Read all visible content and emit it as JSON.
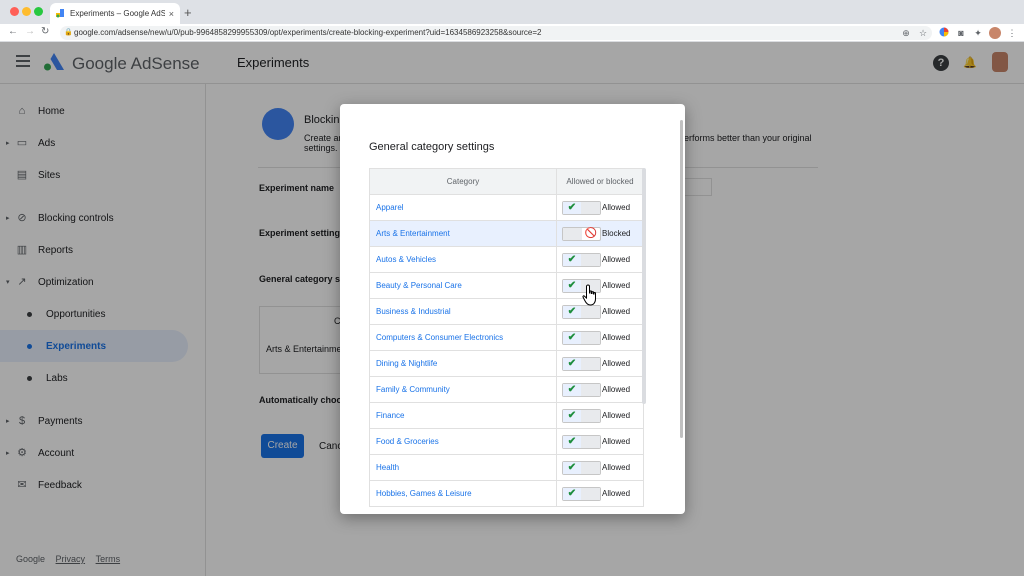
{
  "browser": {
    "tab_title": "Experiments – Google AdSense",
    "tab_close": "×",
    "new_tab": "+",
    "url": "google.com/adsense/new/u/0/pub-9964858299955309/opt/experiments/create-blocking-experiment?uid=1634586923258&source=2"
  },
  "appbar": {
    "brand": "Google AdSense",
    "page_title": "Experiments",
    "help_icon": "?",
    "bell_icon": "🔔"
  },
  "sidebar": {
    "items": [
      {
        "label": "Home",
        "icon": "home-icon"
      },
      {
        "label": "Ads",
        "icon": "ads-icon"
      },
      {
        "label": "Sites",
        "icon": "sites-icon"
      },
      {
        "label": "Blocking controls",
        "icon": "block-icon"
      },
      {
        "label": "Reports",
        "icon": "reports-icon"
      },
      {
        "label": "Optimization",
        "icon": "optimization-icon"
      },
      {
        "label": "Opportunities"
      },
      {
        "label": "Experiments"
      },
      {
        "label": "Labs"
      },
      {
        "label": "Payments",
        "icon": "payments-icon"
      },
      {
        "label": "Account",
        "icon": "account-icon"
      },
      {
        "label": "Feedback",
        "icon": "feedback-icon"
      }
    ],
    "footer": {
      "google": "Google",
      "privacy": "Privacy",
      "terms": "Terms"
    }
  },
  "background": {
    "heading": "Blockin",
    "desc_line1": "Create ar",
    "desc_line2": "settings.",
    "desc_right": "erforms better than your original",
    "experiment_name": "Experiment name",
    "experiment_setting": "Experiment setting",
    "general_category_setting": "General category set",
    "table_header_fragment": "C",
    "table_row": "Arts & Entertainmen",
    "auto_choose": "Automatically choos",
    "create": "Create",
    "cancel": "Canc"
  },
  "dialog": {
    "title": "General category settings",
    "col_category": "Category",
    "col_status": "Allowed or blocked",
    "rows": [
      {
        "category": "Apparel",
        "status": "Allowed"
      },
      {
        "category": "Arts & Entertainment",
        "status": "Blocked"
      },
      {
        "category": "Autos & Vehicles",
        "status": "Allowed"
      },
      {
        "category": "Beauty & Personal Care",
        "status": "Allowed"
      },
      {
        "category": "Business & Industrial",
        "status": "Allowed"
      },
      {
        "category": "Computers & Consumer Electronics",
        "status": "Allowed"
      },
      {
        "category": "Dining & Nightlife",
        "status": "Allowed"
      },
      {
        "category": "Family & Community",
        "status": "Allowed"
      },
      {
        "category": "Finance",
        "status": "Allowed"
      },
      {
        "category": "Food & Groceries",
        "status": "Allowed"
      },
      {
        "category": "Health",
        "status": "Allowed"
      },
      {
        "category": "Hobbies, Games & Leisure",
        "status": "Allowed"
      }
    ]
  },
  "colors": {
    "accent": "#1a73e8",
    "allowed_check": "#1e8e3e",
    "blocked": "#d93025"
  }
}
